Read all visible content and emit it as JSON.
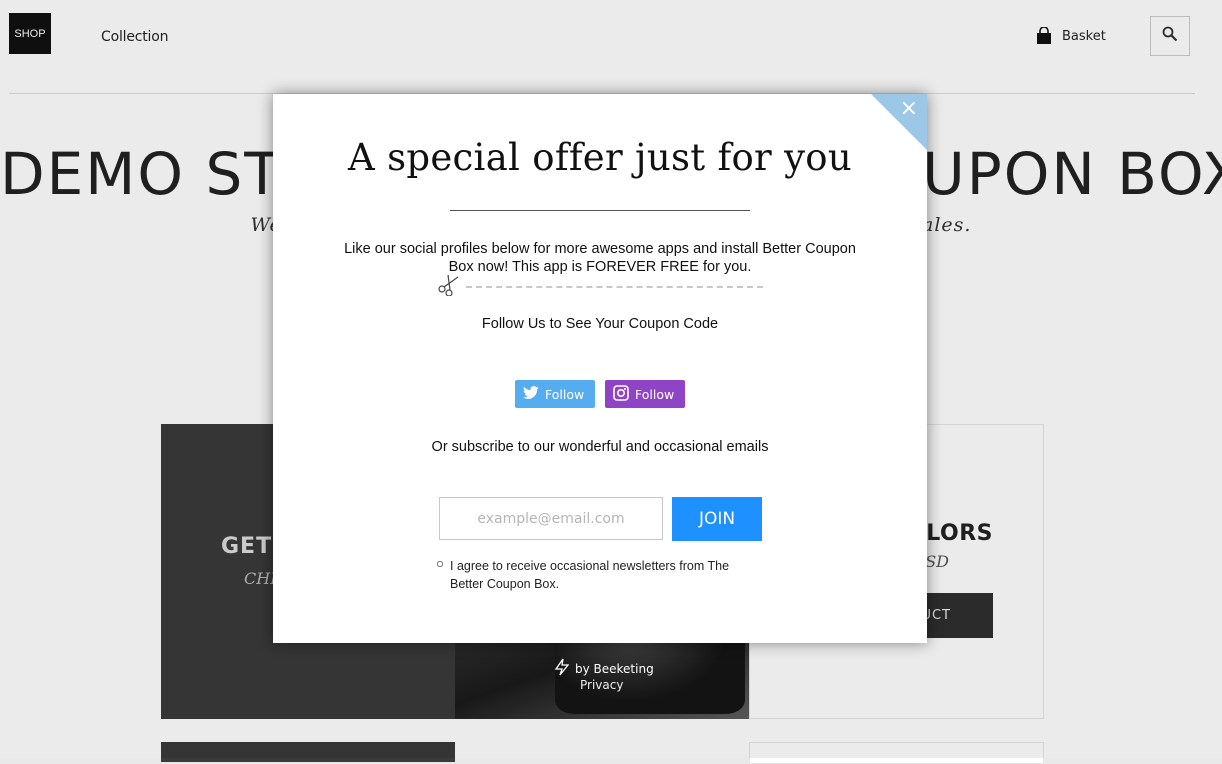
{
  "header": {
    "logo_text": "SHOP",
    "nav": [
      "Collection"
    ],
    "basket_label": "Basket",
    "icons": {
      "basket": "basket-icon",
      "search": "search-icon"
    }
  },
  "hero": {
    "title": "DEMO STORE FOR BETTER COUPON BOX",
    "subtitle": "We will show you how Better Coupon Box helps increase your sales."
  },
  "products": [
    {
      "title": "GET",
      "subtitle": "CHE"
    },
    {
      "title": "YLORS",
      "price": "SD",
      "button": "UCT"
    }
  ],
  "modal": {
    "title": "A special offer just for you",
    "description": "Like our social profiles below for more awesome apps and install Better Coupon Box now! This app is FOREVER FREE for you.",
    "follow_prompt": "Follow Us to See Your Coupon Code",
    "twitter_follow": "Follow",
    "instagram_follow": "Follow",
    "subscribe_prompt": "Or subscribe to our wonderful and occasional emails",
    "email_placeholder": "example@email.com",
    "join_label": "JOIN",
    "agree_text": "I agree to receive occasional newsletters from The Better Coupon Box.",
    "close_symbol": "×",
    "colors": {
      "twitter": "#55acee",
      "instagram": "#8e44c5",
      "join": "#1e90ff",
      "corner": "#9cc7e6"
    }
  },
  "footer": {
    "powered_by": "by Beeketing",
    "privacy": "Privacy"
  }
}
